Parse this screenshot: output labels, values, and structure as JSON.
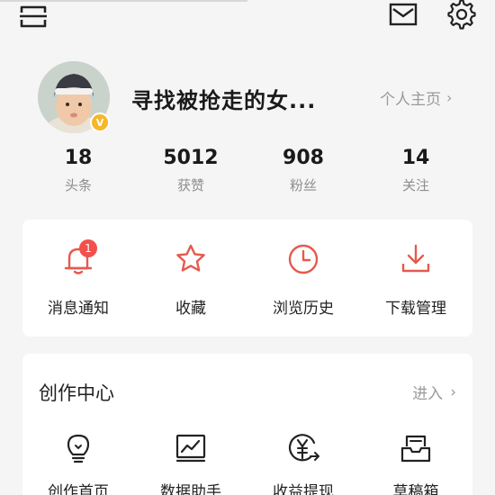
{
  "profile": {
    "username": "寻找被抢走的女...",
    "verified_mark": "V",
    "homepage_label": "个人主页",
    "homepage_chevron": "›"
  },
  "stats": [
    {
      "value": "18",
      "label": "头条"
    },
    {
      "value": "5012",
      "label": "获赞"
    },
    {
      "value": "908",
      "label": "粉丝"
    },
    {
      "value": "14",
      "label": "关注"
    }
  ],
  "quick_actions": [
    {
      "label": "消息通知",
      "icon": "bell-icon",
      "badge": "1"
    },
    {
      "label": "收藏",
      "icon": "star-icon"
    },
    {
      "label": "浏览历史",
      "icon": "clock-icon"
    },
    {
      "label": "下载管理",
      "icon": "download-icon"
    }
  ],
  "creator_center": {
    "title": "创作中心",
    "enter_label": "进入",
    "enter_chevron": "›",
    "items": [
      {
        "label": "创作首页",
        "icon": "lightbulb-icon"
      },
      {
        "label": "数据助手",
        "icon": "chart-icon"
      },
      {
        "label": "收益提现",
        "icon": "yuan-coin-icon"
      },
      {
        "label": "草稿箱",
        "icon": "drafts-box-icon"
      }
    ]
  },
  "colors": {
    "accent_red": "#e55a4e",
    "badge_gold": "#f6b72d",
    "muted_text": "#9a9a9a",
    "background": "#f5f5f5",
    "card": "#ffffff"
  }
}
